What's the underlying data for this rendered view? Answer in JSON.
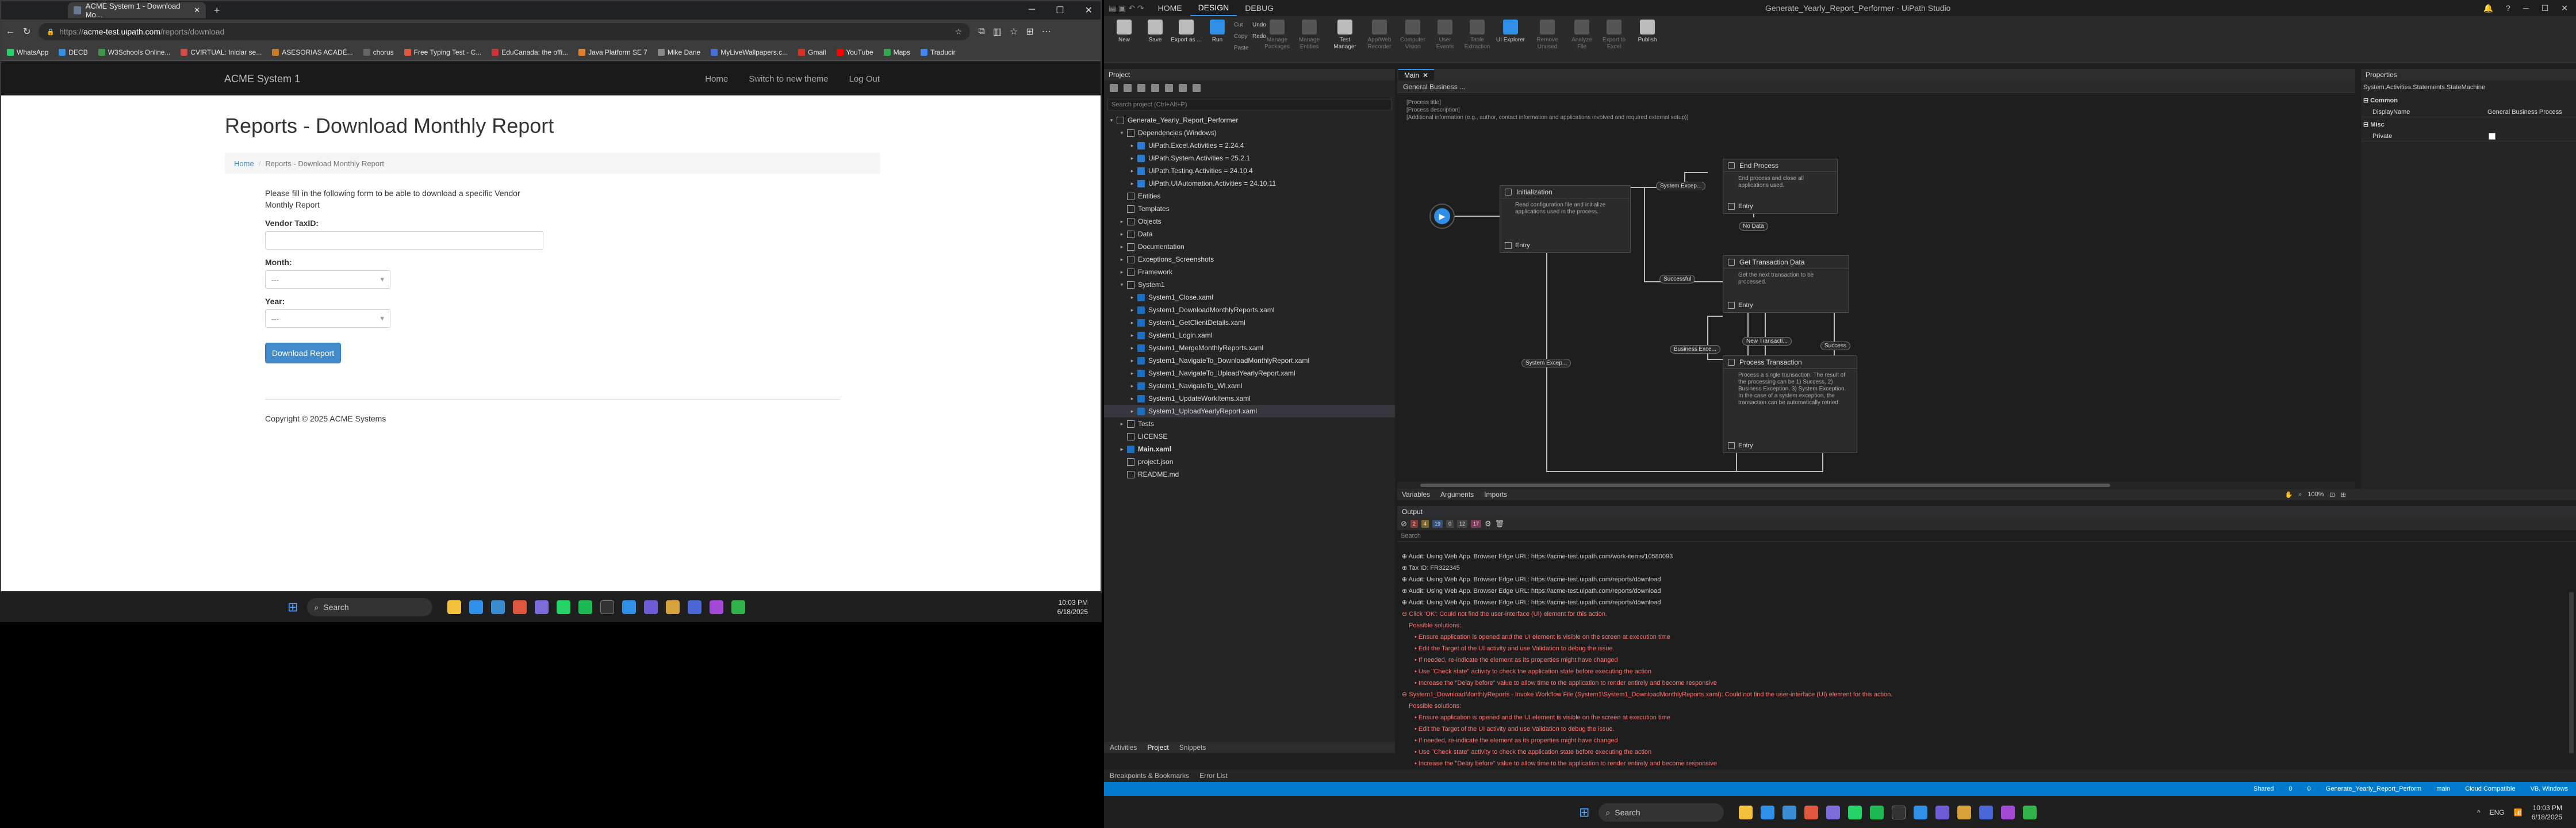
{
  "browser": {
    "tab_title": "ACME System 1 - Download Mo...",
    "url_host": "acme-test.uipath.com",
    "url_path": "/reports/download",
    "url_prefix": "https://",
    "bookmarks": [
      "WhatsApp",
      "DECB",
      "W3Schools Online...",
      "CVIRTUAL: Iniciar se...",
      "ASESORIAS ACADÉ...",
      "chorus",
      "Free Typing Test - C...",
      "EduCanada: the offi...",
      "Java Platform SE 7",
      "Mike Dane",
      "MyLiveWallpapers.c...",
      "Gmail",
      "YouTube",
      "Maps",
      "Traducir"
    ]
  },
  "site": {
    "brand": "ACME System 1",
    "nav": [
      "Home",
      "Switch to new theme",
      "Log Out"
    ],
    "title": "Reports - Download Monthly Report",
    "crumb_home": "Home",
    "crumb_sep": "/",
    "crumb_current": "Reports - Download Monthly Report",
    "intro": "Please fill in the following form to be able to download a specific Vendor Monthly Report",
    "vendor_label": "Vendor TaxID:",
    "month_label": "Month:",
    "year_label": "Year:",
    "select_placeholder": "---",
    "button": "Download Report",
    "footer": "Copyright © 2025 ACME Systems"
  },
  "taskbar_left": {
    "search": "Search",
    "time": "10:03 PM",
    "date": "6/18/2025"
  },
  "studio": {
    "menu_tabs": [
      "HOME",
      "DESIGN",
      "DEBUG"
    ],
    "active_menu": "DESIGN",
    "title": "Generate_Yearly_Report_Performer - UiPath Studio",
    "ribbon": [
      {
        "label": "New",
        "dim": false
      },
      {
        "label": "Save",
        "dim": false
      },
      {
        "label": "Export as ...",
        "dim": false
      },
      {
        "label": "Run",
        "dim": false
      },
      {
        "label": "Manage Packages",
        "dim": true
      },
      {
        "label": "Manage Entities",
        "dim": true
      },
      {
        "label": "Test Manager",
        "dim": false
      },
      {
        "label": "App/Web Recorder",
        "dim": true
      },
      {
        "label": "Computer Vision",
        "dim": true
      },
      {
        "label": "User Events",
        "dim": true
      },
      {
        "label": "Table Extraction",
        "dim": true
      },
      {
        "label": "UI Explorer",
        "dim": false
      },
      {
        "label": "Remove Unused",
        "dim": true
      },
      {
        "label": "Analyze File",
        "dim": true
      },
      {
        "label": "Export to Excel",
        "dim": true
      },
      {
        "label": "Publish",
        "dim": false
      }
    ],
    "ribbon_small": [
      "Cut",
      "Copy",
      "Paste",
      "Undo",
      "Redo"
    ],
    "project_header": "Project",
    "project_search": "Search project (Ctrl+Alt+P)",
    "tree": [
      {
        "label": "Generate_Yearly_Report_Performer",
        "lvl": 0,
        "ar": "▾",
        "ico": "file",
        "bold": false
      },
      {
        "label": "Dependencies (Windows)",
        "lvl": 1,
        "ar": "▾",
        "ico": "file"
      },
      {
        "label": "UiPath.Excel.Activities = 2.24.4",
        "lvl": 2,
        "ar": "▸",
        "ico": "pkg"
      },
      {
        "label": "UiPath.System.Activities = 25.2.1",
        "lvl": 2,
        "ar": "▸",
        "ico": "pkg"
      },
      {
        "label": "UiPath.Testing.Activities = 24.10.4",
        "lvl": 2,
        "ar": "▸",
        "ico": "pkg"
      },
      {
        "label": "UiPath.UIAutomation.Activities = 24.10.11",
        "lvl": 2,
        "ar": "▸",
        "ico": "pkg"
      },
      {
        "label": "Entities",
        "lvl": 1,
        "ar": "",
        "ico": "file"
      },
      {
        "label": "Templates",
        "lvl": 1,
        "ar": "",
        "ico": "file"
      },
      {
        "label": "Objects",
        "lvl": 1,
        "ar": "▸",
        "ico": "file"
      },
      {
        "label": "Data",
        "lvl": 1,
        "ar": "▸",
        "ico": "file"
      },
      {
        "label": "Documentation",
        "lvl": 1,
        "ar": "▸",
        "ico": "file"
      },
      {
        "label": "Exceptions_Screenshots",
        "lvl": 1,
        "ar": "▸",
        "ico": "file"
      },
      {
        "label": "Framework",
        "lvl": 1,
        "ar": "▸",
        "ico": "file"
      },
      {
        "label": "System1",
        "lvl": 1,
        "ar": "▾",
        "ico": "file"
      },
      {
        "label": "System1_Close.xaml",
        "lvl": 2,
        "ar": "▸",
        "ico": "xaml"
      },
      {
        "label": "System1_DownloadMonthlyReports.xaml",
        "lvl": 2,
        "ar": "▸",
        "ico": "xaml"
      },
      {
        "label": "System1_GetClientDetails.xaml",
        "lvl": 2,
        "ar": "▸",
        "ico": "xaml"
      },
      {
        "label": "System1_Login.xaml",
        "lvl": 2,
        "ar": "▸",
        "ico": "xaml"
      },
      {
        "label": "System1_MergeMonthlyReports.xaml",
        "lvl": 2,
        "ar": "▸",
        "ico": "xaml"
      },
      {
        "label": "System1_NavigateTo_DownloadMonthlyReport.xaml",
        "lvl": 2,
        "ar": "▸",
        "ico": "xaml"
      },
      {
        "label": "System1_NavigateTo_UploadYearlyReport.xaml",
        "lvl": 2,
        "ar": "▸",
        "ico": "xaml"
      },
      {
        "label": "System1_NavigateTo_WI.xaml",
        "lvl": 2,
        "ar": "▸",
        "ico": "xaml"
      },
      {
        "label": "System1_UpdateWorkItems.xaml",
        "lvl": 2,
        "ar": "▸",
        "ico": "xaml"
      },
      {
        "label": "System1_UploadYearlyReport.xaml",
        "lvl": 2,
        "ar": "▸",
        "ico": "xaml",
        "sel": true
      },
      {
        "label": "Tests",
        "lvl": 1,
        "ar": "▸",
        "ico": "file"
      },
      {
        "label": "LICENSE",
        "lvl": 1,
        "ar": "",
        "ico": "file"
      },
      {
        "label": "Main.xaml",
        "lvl": 1,
        "ar": "▸",
        "ico": "xaml",
        "bold": true
      },
      {
        "label": "project.json",
        "lvl": 1,
        "ar": "",
        "ico": "file"
      },
      {
        "label": "README.md",
        "lvl": 1,
        "ar": "",
        "ico": "file"
      }
    ],
    "project_tabs": [
      "Activities",
      "Project",
      "Snippets"
    ],
    "bottom_tabs": [
      "Breakpoints & Bookmarks",
      "Error List"
    ],
    "doc_tab": "Main",
    "wf_title": "General Business ...",
    "annotation": [
      "[Process title]",
      "[Process description]",
      "[Additional information (e.g., author, contact information and applications involved and required external setup)]"
    ],
    "states": {
      "init": {
        "title": "Initialization",
        "desc": "Read configuration file and initialize applications used in the process."
      },
      "end": {
        "title": "End Process",
        "desc": "End process and close all applications used."
      },
      "get": {
        "title": "Get Transaction Data",
        "desc": "Get the next transaction to be processed."
      },
      "proc": {
        "title": "Process Transaction",
        "desc": "Process a single transaction. The result of the processing can be 1) Success, 2) Business Exception, 3) System Exception. In the case of a system exception, the transaction can be automatically retried."
      }
    },
    "entry": "Entry",
    "transitions": {
      "sysexc1": "System Excep...",
      "nodata": "No Data",
      "successful": "Successful",
      "newtrans": "New Transacti...",
      "busexc": "Business Exce...",
      "success": "Success",
      "sysexc2": "System Excep..."
    },
    "vars_tabs": [
      "Variables",
      "Arguments",
      "Imports"
    ],
    "zoom": "100%",
    "props_header": "Properties",
    "props_class": "System.Activities.Statements.StateMachine",
    "props_cat1": "Common",
    "props_cat2": "Misc",
    "props_rows": [
      {
        "k": "DisplayName",
        "v": "General Business Process"
      },
      {
        "k": "Private",
        "v": ""
      }
    ],
    "output_header": "Output",
    "output_filters": [
      "2",
      "4",
      "19",
      "0",
      "12",
      "17"
    ],
    "output_search": "Search",
    "output_lines": [
      {
        "t": "info",
        "s": "⊕  Audit: Using Web App. Browser Edge URL: https://acme-test.uipath.com/work-items/10580093"
      },
      {
        "t": "info",
        "s": "⊕  Tax ID: FR322345"
      },
      {
        "t": "info",
        "s": "⊕  Audit: Using Web App. Browser Edge URL: https://acme-test.uipath.com/reports/download"
      },
      {
        "t": "info",
        "s": "⊕  Audit: Using Web App. Browser Edge URL: https://acme-test.uipath.com/reports/download"
      },
      {
        "t": "info",
        "s": "⊕  Audit: Using Web App. Browser Edge URL: https://acme-test.uipath.com/reports/download"
      },
      {
        "t": "err",
        "s": "⊖  Click 'OK': Could not find the user-interface (UI) element for this action."
      },
      {
        "t": "errsub",
        "s": "Possible solutions:"
      },
      {
        "t": "errsub2",
        "s": "• Ensure application is opened and the UI element is visible on the screen at execution time"
      },
      {
        "t": "errsub2",
        "s": "• Edit the Target of the UI activity and use Validation to debug the issue."
      },
      {
        "t": "errsub2",
        "s": "• If needed, re-indicate the element as its properties might have changed"
      },
      {
        "t": "errsub2",
        "s": "• Use \"Check state\" activity to check the application state before executing the action"
      },
      {
        "t": "errsub2",
        "s": "• Increase the \"Delay before\" value to allow time to the application to render entirely and become responsive"
      },
      {
        "t": "err",
        "s": "⊖  System1_DownloadMonthlyReports - Invoke Workflow File (System1\\System1_DownloadMonthlyReports.xaml): Could not find the user-interface (UI) element for this action."
      },
      {
        "t": "errsub",
        "s": "Possible solutions:"
      },
      {
        "t": "errsub2",
        "s": "• Ensure application is opened and the UI element is visible on the screen at execution time"
      },
      {
        "t": "errsub2",
        "s": "• Edit the Target of the UI activity and use Validation to debug the issue."
      },
      {
        "t": "errsub2",
        "s": "• If needed, re-indicate the element as its properties might have changed"
      },
      {
        "t": "errsub2",
        "s": "• Use \"Check state\" activity to check the application state before executing the action"
      },
      {
        "t": "errsub2",
        "s": "• Increase the \"Delay before\" value to allow time to the application to render entirely and become responsive"
      }
    ],
    "status_items": [
      "Shared",
      "0",
      "0",
      "Generate_Yearly_Report_Perform",
      "main",
      "Cloud Compatible",
      "VB, Windows"
    ]
  },
  "taskbar_right": {
    "search": "Search",
    "lang": "ENG",
    "time": "10:03 PM",
    "date": "6/18/2025"
  },
  "colors": {
    "accent": "#2f8ee5",
    "button": "#428bca",
    "error": "#ff7070",
    "statusbar": "#007acc"
  }
}
